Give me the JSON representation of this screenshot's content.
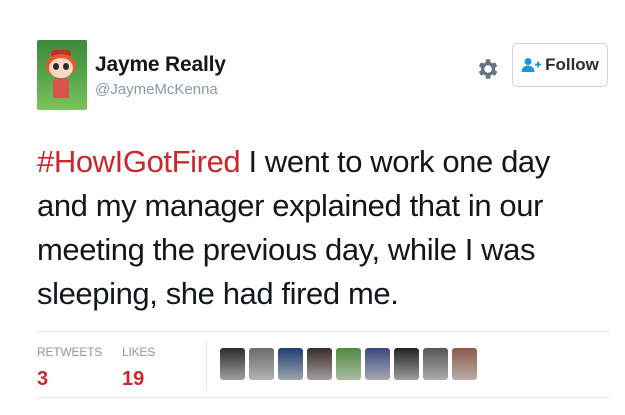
{
  "user": {
    "name": "Jayme Really",
    "handle": "@JaymeMcKenna"
  },
  "follow_button": {
    "label": "Follow"
  },
  "tweet": {
    "hashtag": "#HowIGotFired",
    "text": " I went to work one day and my manager explained that in our meeting the previous day, while I was sleeping, she had fired me."
  },
  "stats": {
    "retweets_label": "RETWEETS",
    "retweets": "3",
    "likes_label": "LIKES",
    "likes": "19"
  },
  "likers": [
    {
      "icon": "user-avatar",
      "color": "#2b2b2b"
    },
    {
      "icon": "user-avatar",
      "color": "#6b6b6b"
    },
    {
      "icon": "user-avatar",
      "color": "#1f3f6e"
    },
    {
      "icon": "user-avatar",
      "color": "#3a2a2a"
    },
    {
      "icon": "user-avatar",
      "color": "#4f8a3f"
    },
    {
      "icon": "user-avatar",
      "color": "#3b4a7a"
    },
    {
      "icon": "user-avatar",
      "color": "#222222"
    },
    {
      "icon": "user-avatar",
      "color": "#555555"
    },
    {
      "icon": "user-avatar",
      "color": "#8a5a4a"
    }
  ],
  "colors": {
    "hashtag": "#c9282d",
    "stat_value": "#c9282d",
    "muted": "#8899a6"
  }
}
